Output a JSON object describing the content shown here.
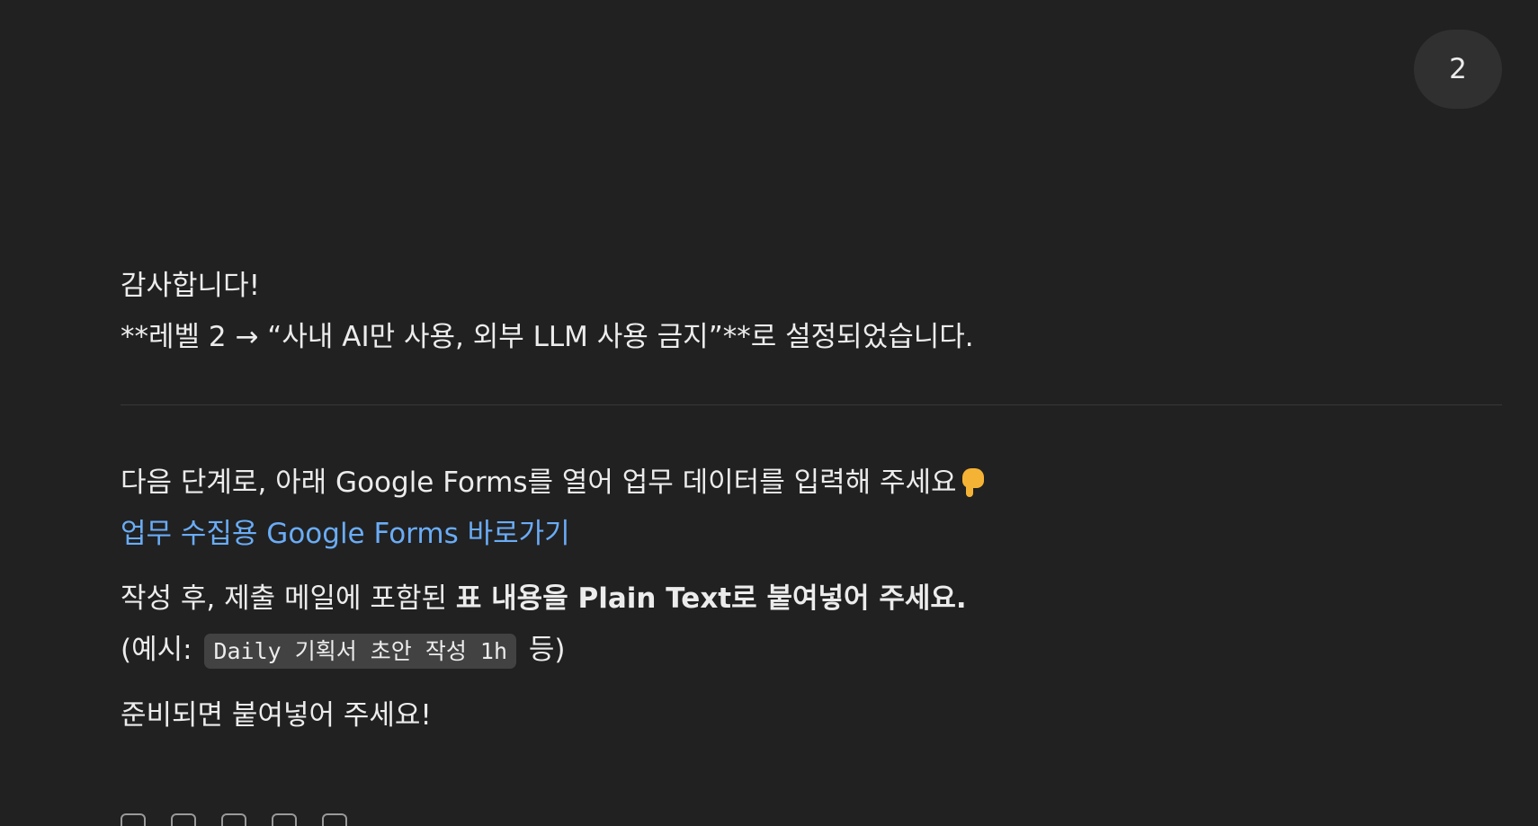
{
  "user_message": {
    "text": "2"
  },
  "assistant": {
    "thanks": "감사합니다!",
    "level_line": "**레벨 2 → “사내 AI만 사용, 외부 LLM 사용 금지”**로 설정되었습니다.",
    "next_step": "다음 단계로, 아래 Google Forms를 열어 업무 데이터를 입력해 주세요",
    "next_step_emoji": "backhand-index-pointing-down",
    "forms_link": "업무 수집용 Google Forms 바로가기",
    "after_submit_prefix": "작성 후, 제출 메일에 포함된 ",
    "after_submit_bold": "표 내용을 Plain Text로 붙여넣어 주세요.",
    "example_prefix": "(예시: ",
    "example_code": "Daily 기획서 초안 작성 1h",
    "example_suffix": " 등)",
    "ready": "준비되면 붙여넣어 주세요!"
  },
  "colors": {
    "background": "#212121",
    "text": "#ececec",
    "link": "#6aacf6",
    "bubble": "#303030"
  }
}
